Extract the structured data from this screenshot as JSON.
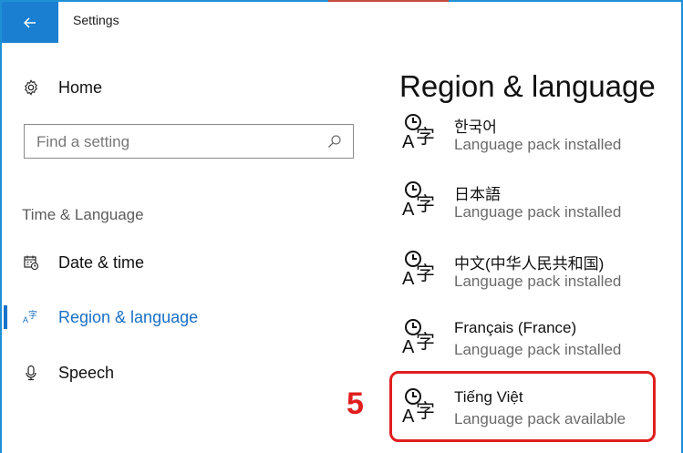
{
  "window": {
    "title": "Settings"
  },
  "sidebar": {
    "home_label": "Home",
    "search_placeholder": "Find a setting",
    "section_label": "Time & Language",
    "items": [
      {
        "label": "Date & time",
        "icon": "calendar-clock-icon"
      },
      {
        "label": "Region & language",
        "icon": "language-icon",
        "active": true
      },
      {
        "label": "Speech",
        "icon": "microphone-icon"
      }
    ]
  },
  "main": {
    "title": "Region & language",
    "languages": [
      {
        "name": "한국어",
        "status": "Language pack installed"
      },
      {
        "name": "日本語",
        "status": "Language pack installed"
      },
      {
        "name": "中文(中华人民共和国)",
        "status": "Language pack installed"
      },
      {
        "name": "Français (France)",
        "status": "Language pack installed"
      },
      {
        "name": "Tiếng Việt",
        "status": "Language pack available"
      }
    ]
  },
  "annotation": {
    "step": "5",
    "color": "#e01e1e"
  },
  "colors": {
    "accent": "#1a7fd1",
    "active_text": "#1a6fc4"
  }
}
